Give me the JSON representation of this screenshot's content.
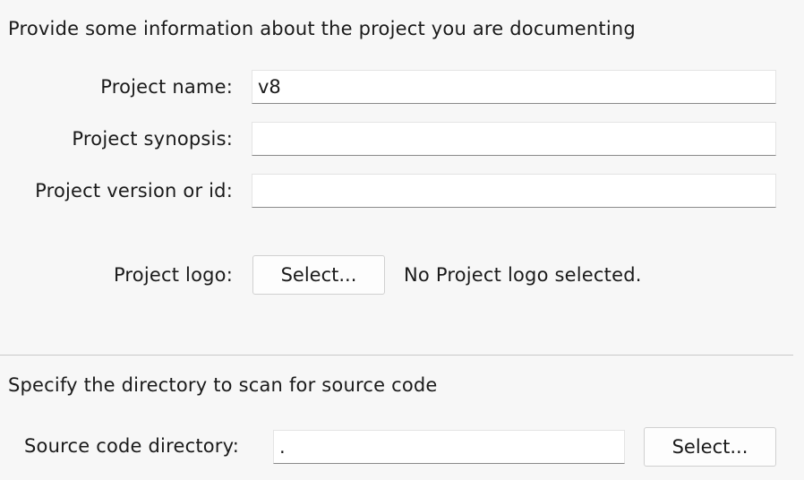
{
  "project_section": {
    "title": "Provide some information about the project you are documenting",
    "name_label": "Project name:",
    "name_value": "v8",
    "synopsis_label": "Project synopsis:",
    "synopsis_value": "",
    "version_label": "Project version or id:",
    "version_value": "",
    "logo_label": "Project logo:",
    "logo_button": "Select...",
    "logo_status": "No Project logo selected."
  },
  "source_section": {
    "title": "Specify the directory to scan for source code",
    "directory_label": "Source code directory:",
    "directory_value": ".",
    "directory_button": "Select..."
  }
}
